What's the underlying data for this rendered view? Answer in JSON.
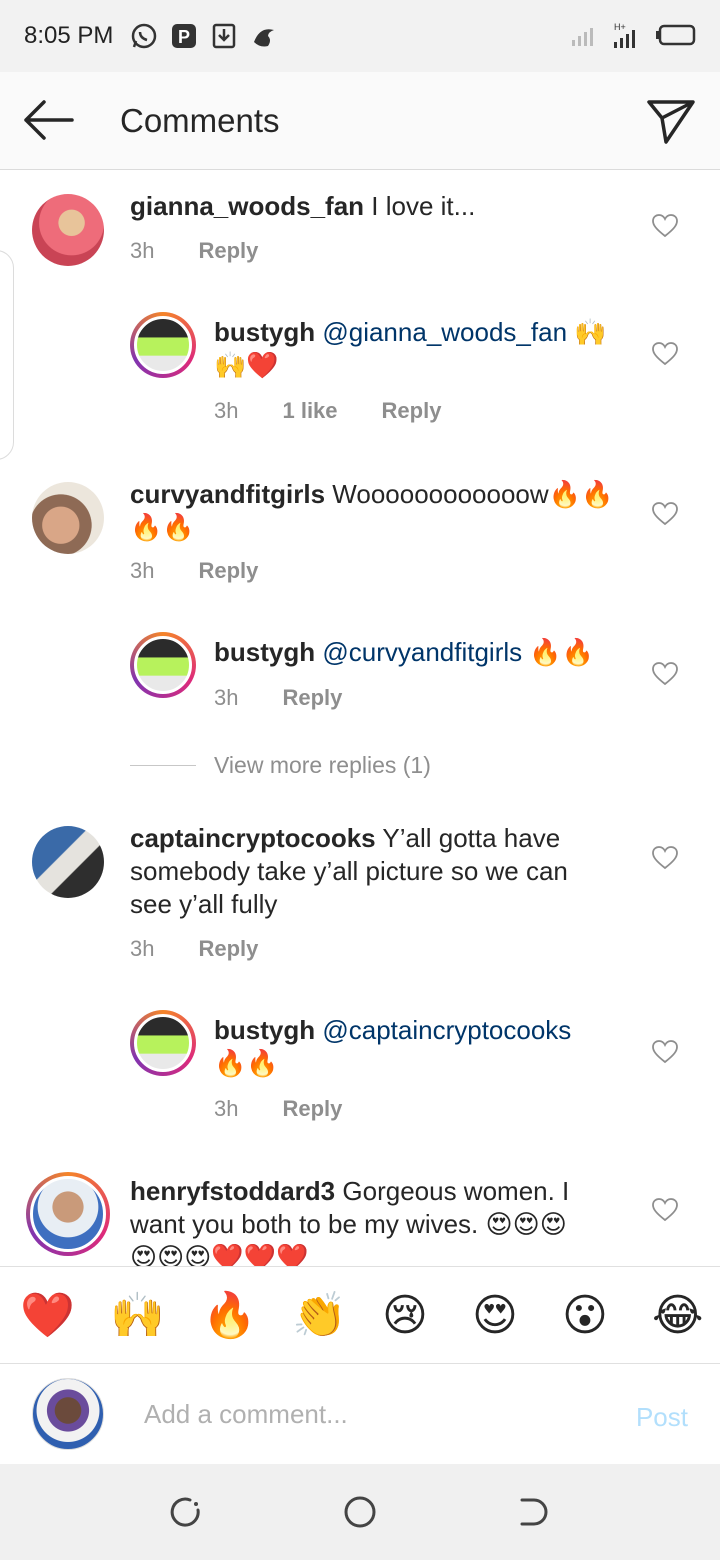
{
  "status_bar": {
    "time": "8:05 PM",
    "left_icons": [
      "whatsapp-icon",
      "p-icon",
      "download-icon",
      "hand-icon"
    ],
    "right_icons": [
      "signal-icon",
      "hplus-signal-icon",
      "battery-icon"
    ]
  },
  "header": {
    "title": "Comments",
    "back_icon": "back-arrow-icon",
    "send_icon": "direct-send-icon"
  },
  "comments": [
    {
      "username": "gianna_woods_fan",
      "text": "I love it...",
      "time": "3h",
      "reply": "Reply",
      "reply_level": 0
    },
    {
      "username": "bustygh",
      "mention": "@gianna_woods_fan",
      "text_line1": "🙌",
      "text_line2": "🙌❤️",
      "time": "3h",
      "likes": "1 like",
      "reply": "Reply",
      "reply_level": 1
    },
    {
      "username": "curvyandfitgirls",
      "text": "Woooooooooooow🔥🔥",
      "text_line2": "🔥🔥",
      "time": "3h",
      "reply": "Reply",
      "reply_level": 0
    },
    {
      "username": "bustygh",
      "mention": "@curvyandfitgirls",
      "text": "🔥🔥",
      "time": "3h",
      "reply": "Reply",
      "reply_level": 1
    },
    {
      "username": "captaincryptocooks",
      "text_line1": "Y’all gotta have",
      "text_line2": "somebody take y’all picture so we can",
      "text_line3": "see y’all fully",
      "time": "3h",
      "reply": "Reply",
      "reply_level": 0
    },
    {
      "username": "bustygh",
      "mention": "@captaincryptocooks",
      "text_line2": "🔥🔥",
      "time": "3h",
      "reply": "Reply",
      "reply_level": 1
    },
    {
      "username": "henryfstoddard3",
      "text_line1": "Gorgeous women. I",
      "text_line2": "want you both to be my wives. 😍😍😍",
      "text_line3": "😍😍😍❤️❤️❤️",
      "reply_level": 0
    }
  ],
  "view_more_replies": "View more replies (1)",
  "emoji_bar": [
    "❤️",
    "🙌",
    "🔥",
    "👏",
    "😢",
    "😍",
    "😮",
    "😂"
  ],
  "add_comment": {
    "placeholder": "Add a comment...",
    "post_label": "Post"
  },
  "nav_bar": [
    "recents-icon",
    "home-icon",
    "back-icon"
  ]
}
